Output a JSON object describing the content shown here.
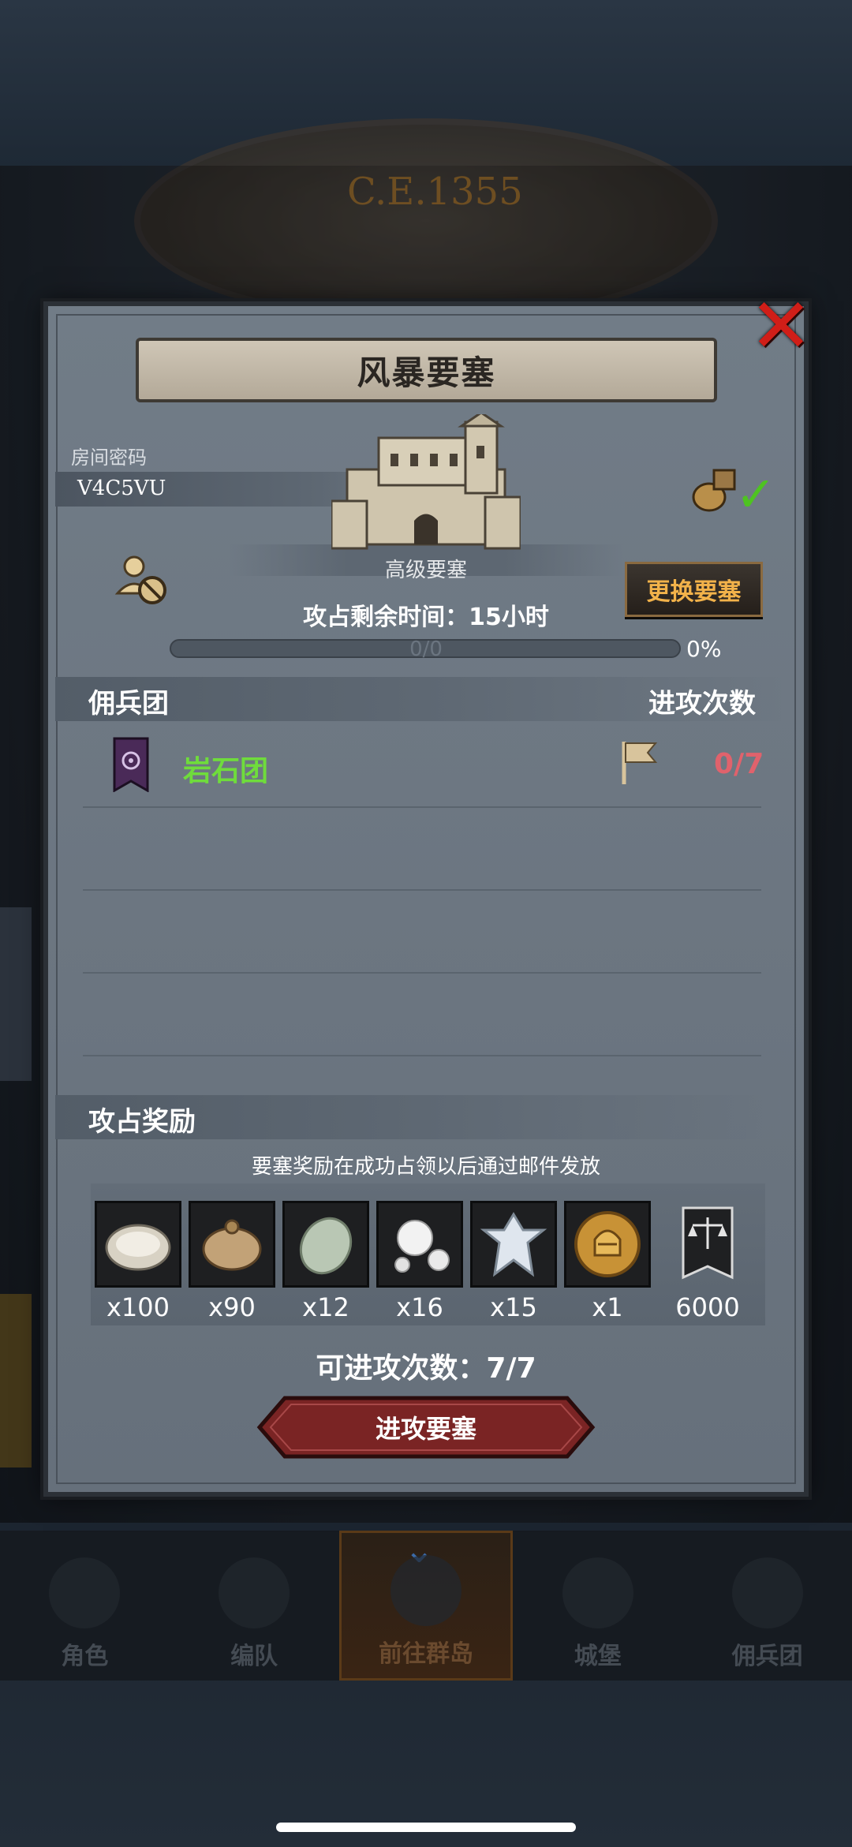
{
  "background": {
    "era_label": "C.E.1355"
  },
  "dialog": {
    "title": "风暴要塞",
    "close_icon": "close-icon",
    "room": {
      "label": "房间密码",
      "code": "V4C5VU"
    },
    "fortress_level": "高级要塞",
    "change_fortress_label": "更换要塞",
    "time_remaining": "攻占剩余时间：15小时",
    "progress": {
      "text": "0/0",
      "percent": "0%",
      "fraction": 0
    },
    "mercenary_section": {
      "title": "佣兵团",
      "attack_count_header": "进攻次数",
      "rows": [
        {
          "name": "岩石团",
          "attacks": "0/7"
        }
      ]
    },
    "reward_section": {
      "title": "攻占奖励",
      "note": "要塞奖励在成功占领以后通过邮件发放",
      "items": [
        {
          "icon": "oyster-icon",
          "qty": "x100"
        },
        {
          "icon": "sack-icon",
          "qty": "x90"
        },
        {
          "icon": "jade-stone-icon",
          "qty": "x12"
        },
        {
          "icon": "pearls-icon",
          "qty": "x16"
        },
        {
          "icon": "silver-emblem-icon",
          "qty": "x15"
        },
        {
          "icon": "golden-helmet-coin-icon",
          "qty": "x1"
        },
        {
          "icon": "justice-banner-icon",
          "qty": "6000"
        }
      ]
    },
    "attacks_available": "可进攻次数：7/7",
    "attack_button_label": "进攻要塞"
  },
  "bottom_nav": {
    "tabs": [
      {
        "label": "角色",
        "active": false
      },
      {
        "label": "编队",
        "active": false
      },
      {
        "label": "前往群岛",
        "active": true
      },
      {
        "label": "城堡",
        "active": false
      },
      {
        "label": "佣兵团",
        "active": false
      }
    ]
  },
  "colors": {
    "accent_green": "#6fdc3c",
    "attack_count_red": "#e0626c",
    "change_button_text": "#f2b24a",
    "close_red": "#d01e18",
    "check_green": "#4ec321"
  }
}
